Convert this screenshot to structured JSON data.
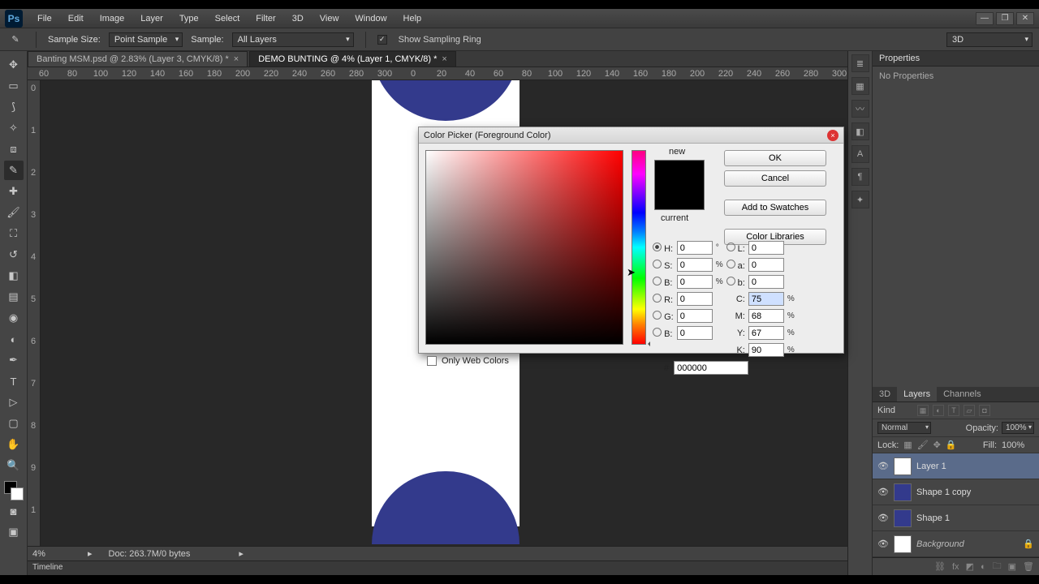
{
  "menu": {
    "items": [
      "File",
      "Edit",
      "Image",
      "Layer",
      "Type",
      "Select",
      "Filter",
      "3D",
      "View",
      "Window",
      "Help"
    ]
  },
  "optbar": {
    "sample_size_label": "Sample Size:",
    "sample_size_value": "Point Sample",
    "sample_label": "Sample:",
    "sample_value": "All Layers",
    "show_ring": "Show Sampling Ring",
    "threeD": "3D"
  },
  "tabs": [
    {
      "label": "Banting MSM.psd @ 2.83% (Layer 3, CMYK/8) *",
      "active": false
    },
    {
      "label": "DEMO BUNTING @ 4% (Layer 1, CMYK/8) *",
      "active": true
    }
  ],
  "ruler_h": [
    "60",
    "80",
    "100",
    "120",
    "140",
    "160",
    "180",
    "200",
    "220",
    "240",
    "260",
    "280",
    "300",
    "0",
    "20",
    "40",
    "60",
    "80",
    "100",
    "120",
    "140",
    "160",
    "180",
    "200",
    "220",
    "240",
    "260",
    "280",
    "300"
  ],
  "ruler_v": [
    "0",
    "1",
    "2",
    "3",
    "4",
    "5",
    "6",
    "7",
    "8",
    "9",
    "1"
  ],
  "status": {
    "zoom": "4%",
    "doc": "Doc: 263.7M/0 bytes"
  },
  "timeline": "Timeline",
  "properties": {
    "title": "Properties",
    "empty": "No Properties"
  },
  "layerspanel": {
    "tabs": [
      "3D",
      "Layers",
      "Channels"
    ],
    "kind": "Kind",
    "blend": "Normal",
    "opacity_label": "Opacity:",
    "opacity": "100%",
    "lock_label": "Lock:",
    "fill_label": "Fill:",
    "fill": "100%",
    "layers": [
      {
        "name": "Layer 1",
        "selected": true
      },
      {
        "name": "Shape 1 copy"
      },
      {
        "name": "Shape 1"
      },
      {
        "name": "Background",
        "locked": true,
        "italic": true
      }
    ]
  },
  "dialog": {
    "title": "Color Picker (Foreground Color)",
    "new": "new",
    "current": "current",
    "ok": "OK",
    "cancel": "Cancel",
    "add": "Add to Swatches",
    "lib": "Color Libraries",
    "H": "0",
    "S": "0",
    "Bv": "0",
    "R": "0",
    "G": "0",
    "Bb": "0",
    "L": "0",
    "a": "0",
    "b": "0",
    "C": "75",
    "M": "68",
    "Y": "67",
    "K": "90",
    "hex": "000000",
    "webonly": "Only Web Colors",
    "deg": "°",
    "pct": "%",
    "hash": "#",
    "lbl": {
      "H": "H:",
      "S": "S:",
      "B": "B:",
      "R": "R:",
      "G": "G:",
      "Bb": "B:",
      "L": "L:",
      "a": "a:",
      "b": "b:",
      "C": "C:",
      "M": "M:",
      "Y": "Y:",
      "K": "K:"
    }
  }
}
